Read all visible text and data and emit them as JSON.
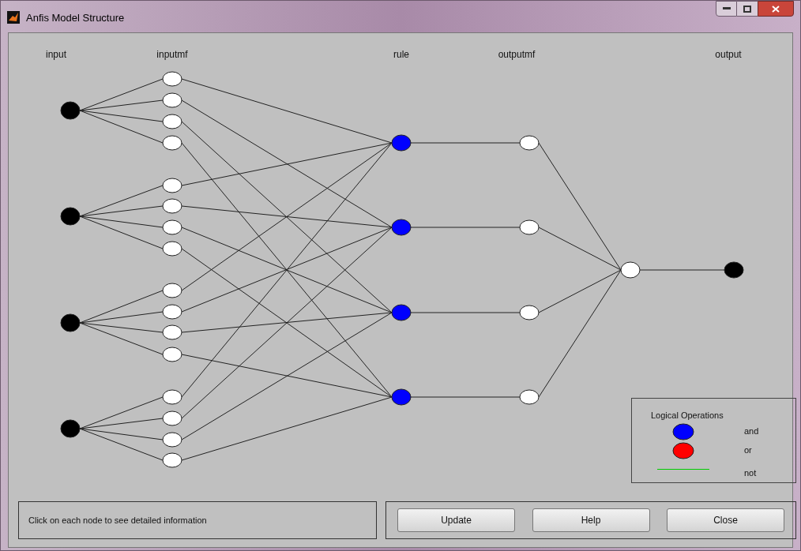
{
  "window": {
    "title": "Anfis Model Structure"
  },
  "layers": [
    {
      "label": "input"
    },
    {
      "label": "inputmf"
    },
    {
      "label": "rule"
    },
    {
      "label": "outputmf"
    },
    {
      "label": "output"
    }
  ],
  "inputs": [
    {
      "mfs": [
        {
          "kind": "mf"
        },
        {
          "kind": "mf"
        },
        {
          "kind": "mf"
        },
        {
          "kind": "mf"
        }
      ]
    },
    {
      "mfs": [
        {
          "kind": "mf"
        },
        {
          "kind": "mf"
        },
        {
          "kind": "mf"
        },
        {
          "kind": "mf"
        }
      ]
    },
    {
      "mfs": [
        {
          "kind": "mf"
        },
        {
          "kind": "mf"
        },
        {
          "kind": "mf"
        },
        {
          "kind": "mf"
        }
      ]
    },
    {
      "mfs": [
        {
          "kind": "mf"
        },
        {
          "kind": "mf"
        },
        {
          "kind": "mf"
        },
        {
          "kind": "mf"
        }
      ]
    }
  ],
  "rules": [
    {
      "color": "#0000ff"
    },
    {
      "color": "#0000ff"
    },
    {
      "color": "#0000ff"
    },
    {
      "color": "#0000ff"
    }
  ],
  "legend": {
    "title": "Logical Operations",
    "items": [
      {
        "kind": "dot",
        "color": "#0000ff",
        "label": "and"
      },
      {
        "kind": "dot",
        "color": "#ff0000",
        "label": "or"
      },
      {
        "kind": "line",
        "color": "#00cc00",
        "label": "not"
      }
    ]
  },
  "status": "Click on each node to see detailed information",
  "buttons": [
    "Update",
    "Help",
    "Close"
  ]
}
